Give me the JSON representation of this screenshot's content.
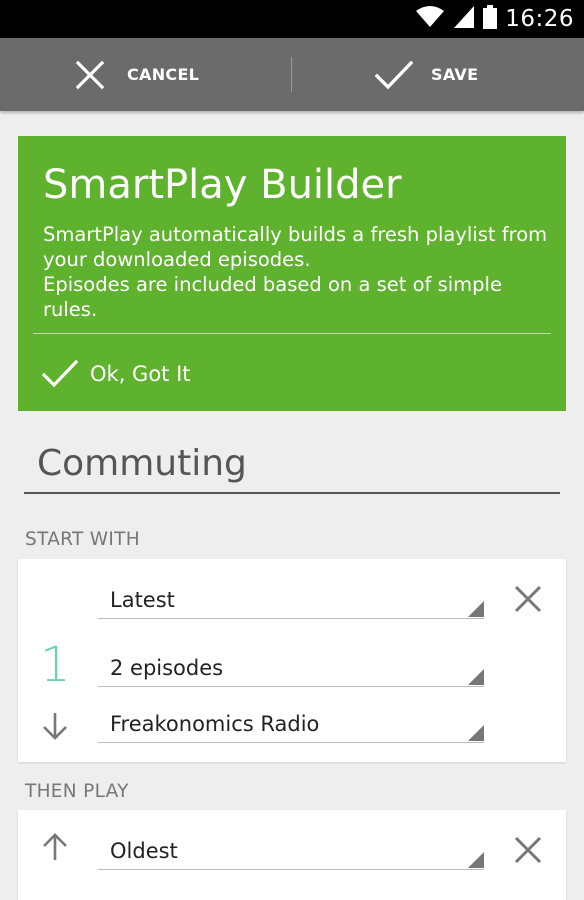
{
  "status_bar": {
    "time": "16:26",
    "icons": [
      "wifi-icon",
      "cell-signal-icon",
      "battery-icon"
    ]
  },
  "action_bar": {
    "cancel_label": "CANCEL",
    "save_label": "SAVE"
  },
  "intro_card": {
    "title": "SmartPlay Builder",
    "body_line1": "SmartPlay automatically builds a fresh playlist from your downloaded episodes.",
    "body_line2": "Episodes are included based on a set of simple rules.",
    "dismiss_label": "Ok, Got It",
    "color": "#5fb22e"
  },
  "playlist_name": {
    "value": "Commuting"
  },
  "start_with": {
    "header": "START WITH",
    "rule_number": "1",
    "order": "Latest",
    "count": "2 episodes",
    "podcast": "Freakonomics Radio"
  },
  "then_play": {
    "header": "THEN PLAY",
    "order": "Oldest"
  },
  "colors": {
    "accent_number": "#6ed1b2",
    "action_bar": "#6b6b6b"
  }
}
